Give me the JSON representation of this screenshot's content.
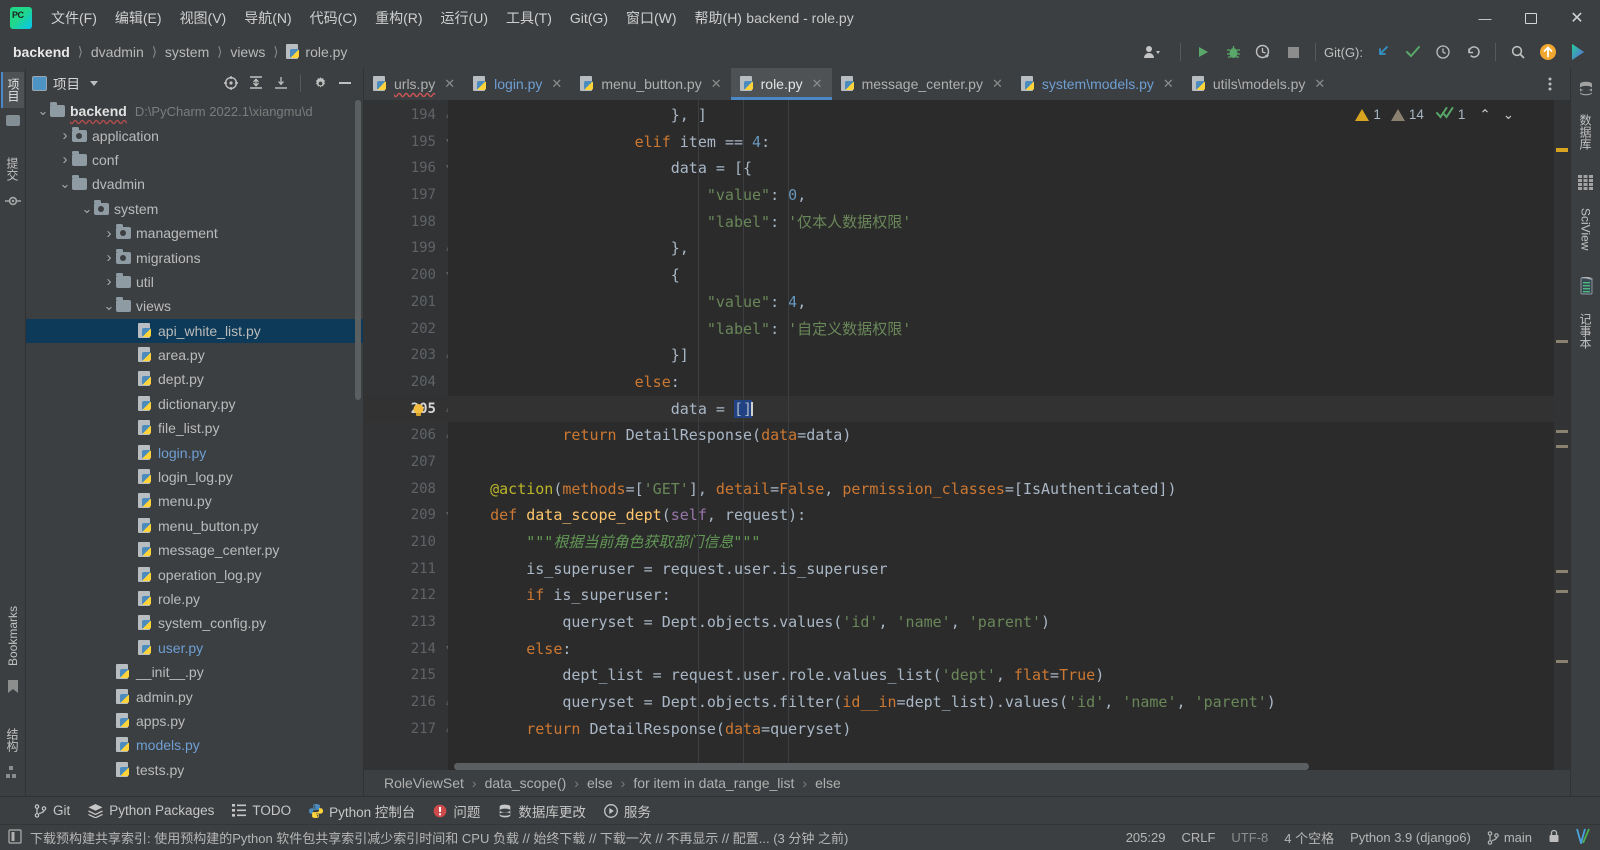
{
  "window": {
    "title": "backend - role.py",
    "minimize": "—",
    "maximize": "❐",
    "close": "✕"
  },
  "menubar": [
    {
      "label": "文件(F)"
    },
    {
      "label": "编辑(E)"
    },
    {
      "label": "视图(V)"
    },
    {
      "label": "导航(N)"
    },
    {
      "label": "代码(C)"
    },
    {
      "label": "重构(R)"
    },
    {
      "label": "运行(U)"
    },
    {
      "label": "工具(T)"
    },
    {
      "label": "Git(G)"
    },
    {
      "label": "窗口(W)"
    },
    {
      "label": "帮助(H)"
    }
  ],
  "navbar": {
    "crumbs": [
      "backend",
      "dvadmin",
      "system",
      "views",
      "role.py"
    ],
    "git_label": "Git(G):",
    "buttons": [
      {
        "name": "profile-dropdown",
        "glyph": "⛭"
      },
      {
        "name": "run-button",
        "glyph": "▶"
      },
      {
        "name": "debug-button",
        "glyph": "☢"
      },
      {
        "name": "run-coverage-button",
        "glyph": "⏱"
      },
      {
        "name": "stop-button",
        "glyph": "■"
      },
      {
        "name": "git-update-button",
        "glyph": "↙"
      },
      {
        "name": "git-commit-button",
        "glyph": "✓"
      },
      {
        "name": "git-history-button",
        "glyph": "◷"
      },
      {
        "name": "git-rollback-button",
        "glyph": "↶"
      },
      {
        "name": "search-everywhere-button",
        "glyph": "⌕"
      },
      {
        "name": "update-available-button",
        "glyph": "↑"
      },
      {
        "name": "feedback-button",
        "glyph": "▶"
      }
    ]
  },
  "left_strip": {
    "tabs": [
      {
        "label": "项目",
        "name": "tool-tab-project",
        "active": true
      },
      {
        "label": "提交",
        "name": "tool-tab-commit",
        "active": false
      }
    ],
    "bottom_tabs": [
      {
        "label": "Bookmarks",
        "name": "tool-tab-bookmarks"
      },
      {
        "label": "结构",
        "name": "tool-tab-structure"
      }
    ]
  },
  "right_strip": {
    "tabs": [
      {
        "label": "数据库",
        "name": "tool-tab-database"
      },
      {
        "label": "SciView",
        "name": "tool-tab-sciview"
      },
      {
        "label": "记事本",
        "name": "tool-tab-notebook"
      }
    ]
  },
  "project_panel": {
    "title": "项目",
    "toolbar": [
      {
        "name": "select-opened-file-icon",
        "glyph": "⊕"
      },
      {
        "name": "expand-all-icon",
        "glyph": "⩯"
      },
      {
        "name": "collapse-all-icon",
        "glyph": "⩰"
      },
      {
        "name": "settings-gear-icon",
        "glyph": "⚙"
      },
      {
        "name": "hide-panel-icon",
        "glyph": "—"
      }
    ],
    "tree": [
      {
        "label": "backend",
        "path": "D:\\PyCharm 2022.1\\xiangmu\\d",
        "indent": 0,
        "arrow": "v",
        "icon": "folder",
        "bold": true,
        "type": "folder"
      },
      {
        "label": "application",
        "indent": 1,
        "arrow": ">",
        "icon": "folder-src",
        "type": "folder"
      },
      {
        "label": "conf",
        "indent": 1,
        "arrow": ">",
        "icon": "folder",
        "type": "folder"
      },
      {
        "label": "dvadmin",
        "indent": 1,
        "arrow": "v",
        "icon": "folder",
        "type": "folder"
      },
      {
        "label": "system",
        "indent": 2,
        "arrow": "v",
        "icon": "folder-src",
        "type": "folder"
      },
      {
        "label": "management",
        "indent": 3,
        "arrow": ">",
        "icon": "folder-src",
        "type": "folder"
      },
      {
        "label": "migrations",
        "indent": 3,
        "arrow": ">",
        "icon": "folder-src",
        "type": "folder"
      },
      {
        "label": "util",
        "indent": 3,
        "arrow": ">",
        "icon": "folder",
        "type": "folder"
      },
      {
        "label": "views",
        "indent": 3,
        "arrow": "v",
        "icon": "folder",
        "type": "folder"
      },
      {
        "label": "api_white_list.py",
        "indent": 4,
        "arrow": "",
        "icon": "py",
        "selected": true,
        "type": "file"
      },
      {
        "label": "area.py",
        "indent": 4,
        "arrow": "",
        "icon": "py",
        "type": "file"
      },
      {
        "label": "dept.py",
        "indent": 4,
        "arrow": "",
        "icon": "py",
        "type": "file"
      },
      {
        "label": "dictionary.py",
        "indent": 4,
        "arrow": "",
        "icon": "py",
        "type": "file"
      },
      {
        "label": "file_list.py",
        "indent": 4,
        "arrow": "",
        "icon": "py",
        "type": "file"
      },
      {
        "label": "login.py",
        "indent": 4,
        "arrow": "",
        "icon": "py",
        "opened": true,
        "type": "file"
      },
      {
        "label": "login_log.py",
        "indent": 4,
        "arrow": "",
        "icon": "py",
        "type": "file"
      },
      {
        "label": "menu.py",
        "indent": 4,
        "arrow": "",
        "icon": "py",
        "type": "file"
      },
      {
        "label": "menu_button.py",
        "indent": 4,
        "arrow": "",
        "icon": "py",
        "type": "file"
      },
      {
        "label": "message_center.py",
        "indent": 4,
        "arrow": "",
        "icon": "py",
        "type": "file"
      },
      {
        "label": "operation_log.py",
        "indent": 4,
        "arrow": "",
        "icon": "py",
        "type": "file"
      },
      {
        "label": "role.py",
        "indent": 4,
        "arrow": "",
        "icon": "py",
        "type": "file"
      },
      {
        "label": "system_config.py",
        "indent": 4,
        "arrow": "",
        "icon": "py",
        "type": "file"
      },
      {
        "label": "user.py",
        "indent": 4,
        "arrow": "",
        "icon": "py",
        "opened": true,
        "type": "file"
      },
      {
        "label": "__init__.py",
        "indent": 3,
        "arrow": "",
        "icon": "py",
        "type": "file"
      },
      {
        "label": "admin.py",
        "indent": 3,
        "arrow": "",
        "icon": "py",
        "type": "file"
      },
      {
        "label": "apps.py",
        "indent": 3,
        "arrow": "",
        "icon": "py",
        "type": "file"
      },
      {
        "label": "models.py",
        "indent": 3,
        "arrow": "",
        "icon": "py",
        "opened": true,
        "type": "file"
      },
      {
        "label": "tests.py",
        "indent": 3,
        "arrow": "",
        "icon": "py",
        "type": "file"
      }
    ]
  },
  "editor": {
    "tabs": [
      {
        "label": "urls.py",
        "active": false,
        "error": true
      },
      {
        "label": "login.py",
        "active": false,
        "blue": true
      },
      {
        "label": "menu_button.py",
        "active": false
      },
      {
        "label": "role.py",
        "active": true
      },
      {
        "label": "message_center.py",
        "active": false
      },
      {
        "label": "system\\models.py",
        "active": false,
        "blue": true
      },
      {
        "label": "utils\\models.py",
        "active": false
      }
    ],
    "inspections": {
      "warnings": "1",
      "weak_warnings": "14",
      "ok": "1",
      "prev_glyph": "⌃",
      "next_glyph": "⌄"
    },
    "first_line": 194,
    "current_line": 205,
    "lines": [
      {
        "n": 194,
        "fold": "△",
        "tokens": [
          {
            "t": "                        }, ]",
            "c": "at"
          }
        ]
      },
      {
        "n": 195,
        "fold": "▽",
        "tokens": [
          {
            "t": "                    ",
            "c": "at"
          },
          {
            "t": "elif",
            "c": "k"
          },
          {
            "t": " item ",
            "c": "at"
          },
          {
            "t": "==",
            "c": "at"
          },
          {
            "t": " ",
            "c": "at"
          },
          {
            "t": "4",
            "c": "n"
          },
          {
            "t": ":",
            "c": "at"
          }
        ]
      },
      {
        "n": 196,
        "fold": "▽",
        "tokens": [
          {
            "t": "                        data = [{",
            "c": "at"
          }
        ]
      },
      {
        "n": 197,
        "fold": "",
        "tokens": [
          {
            "t": "                            ",
            "c": "at"
          },
          {
            "t": "\"value\"",
            "c": "s"
          },
          {
            "t": ": ",
            "c": "at"
          },
          {
            "t": "0",
            "c": "n"
          },
          {
            "t": ",",
            "c": "at"
          }
        ]
      },
      {
        "n": 198,
        "fold": "",
        "tokens": [
          {
            "t": "                            ",
            "c": "at"
          },
          {
            "t": "\"label\"",
            "c": "s"
          },
          {
            "t": ": ",
            "c": "at"
          },
          {
            "t": "'仅本人数据权限'",
            "c": "s"
          }
        ]
      },
      {
        "n": 199,
        "fold": "△",
        "tokens": [
          {
            "t": "                        },",
            "c": "at"
          }
        ]
      },
      {
        "n": 200,
        "fold": "▽",
        "tokens": [
          {
            "t": "                        {",
            "c": "at"
          }
        ]
      },
      {
        "n": 201,
        "fold": "",
        "tokens": [
          {
            "t": "                            ",
            "c": "at"
          },
          {
            "t": "\"value\"",
            "c": "s"
          },
          {
            "t": ": ",
            "c": "at"
          },
          {
            "t": "4",
            "c": "n"
          },
          {
            "t": ",",
            "c": "at"
          }
        ]
      },
      {
        "n": 202,
        "fold": "",
        "tokens": [
          {
            "t": "                            ",
            "c": "at"
          },
          {
            "t": "\"label\"",
            "c": "s"
          },
          {
            "t": ": ",
            "c": "at"
          },
          {
            "t": "'自定义数据权限'",
            "c": "s"
          }
        ]
      },
      {
        "n": 203,
        "fold": "△",
        "tokens": [
          {
            "t": "                        }]",
            "c": "at"
          }
        ]
      },
      {
        "n": 204,
        "fold": "",
        "tokens": [
          {
            "t": "                    ",
            "c": "at"
          },
          {
            "t": "else",
            "c": "k"
          },
          {
            "t": ":",
            "c": "at"
          }
        ]
      },
      {
        "n": 205,
        "fold": "△",
        "current": true,
        "bulb": true,
        "tokens": [
          {
            "t": "                        data = ",
            "c": "at"
          },
          {
            "t": "[]",
            "c": "sel"
          }
        ]
      },
      {
        "n": 206,
        "fold": "△",
        "tokens": [
          {
            "t": "            ",
            "c": "at"
          },
          {
            "t": "return",
            "c": "k"
          },
          {
            "t": " DetailResponse(",
            "c": "at"
          },
          {
            "t": "data",
            "c": "k"
          },
          {
            "t": "=data)",
            "c": "at"
          }
        ]
      },
      {
        "n": 207,
        "fold": "",
        "tokens": [
          {
            "t": "",
            "c": "at"
          }
        ]
      },
      {
        "n": 208,
        "fold": "",
        "tokens": [
          {
            "t": "    ",
            "c": "at"
          },
          {
            "t": "@action",
            "c": "d"
          },
          {
            "t": "(",
            "c": "at"
          },
          {
            "t": "methods",
            "c": "k"
          },
          {
            "t": "=[",
            "c": "at"
          },
          {
            "t": "'GET'",
            "c": "s"
          },
          {
            "t": "], ",
            "c": "at"
          },
          {
            "t": "detail",
            "c": "k"
          },
          {
            "t": "=",
            "c": "at"
          },
          {
            "t": "False",
            "c": "k"
          },
          {
            "t": ", ",
            "c": "at"
          },
          {
            "t": "permission_classes",
            "c": "k"
          },
          {
            "t": "=[IsAuthenticated])",
            "c": "at"
          }
        ]
      },
      {
        "n": 209,
        "fold": "▽",
        "tokens": [
          {
            "t": "    ",
            "c": "at"
          },
          {
            "t": "def",
            "c": "k"
          },
          {
            "t": " ",
            "c": "at"
          },
          {
            "t": "data_scope_dept",
            "c": "f"
          },
          {
            "t": "(",
            "c": "at"
          },
          {
            "t": "self",
            "c": "p"
          },
          {
            "t": ", request):",
            "c": "at"
          }
        ]
      },
      {
        "n": 210,
        "fold": "",
        "tokens": [
          {
            "t": "        ",
            "c": "at"
          },
          {
            "t": "\"\"\"根据当前角色获取部门信息\"\"\"",
            "c": "cm"
          }
        ]
      },
      {
        "n": 211,
        "fold": "",
        "tokens": [
          {
            "t": "        is_superuser = request.user.is_superuser",
            "c": "at"
          }
        ]
      },
      {
        "n": 212,
        "fold": "",
        "tokens": [
          {
            "t": "        ",
            "c": "at"
          },
          {
            "t": "if",
            "c": "k"
          },
          {
            "t": " is_superuser:",
            "c": "at"
          }
        ]
      },
      {
        "n": 213,
        "fold": "",
        "tokens": [
          {
            "t": "            queryset = Dept.objects.values(",
            "c": "at"
          },
          {
            "t": "'id'",
            "c": "s"
          },
          {
            "t": ", ",
            "c": "at"
          },
          {
            "t": "'name'",
            "c": "s"
          },
          {
            "t": ", ",
            "c": "at"
          },
          {
            "t": "'parent'",
            "c": "s"
          },
          {
            "t": ")",
            "c": "at"
          }
        ]
      },
      {
        "n": 214,
        "fold": "▽",
        "tokens": [
          {
            "t": "        ",
            "c": "at"
          },
          {
            "t": "else",
            "c": "k"
          },
          {
            "t": ":",
            "c": "at"
          }
        ]
      },
      {
        "n": 215,
        "fold": "",
        "tokens": [
          {
            "t": "            dept_list = request.user.role.values_list(",
            "c": "at"
          },
          {
            "t": "'dept'",
            "c": "s"
          },
          {
            "t": ", ",
            "c": "at"
          },
          {
            "t": "flat",
            "c": "k"
          },
          {
            "t": "=",
            "c": "at"
          },
          {
            "t": "True",
            "c": "k"
          },
          {
            "t": ")",
            "c": "at"
          }
        ]
      },
      {
        "n": 216,
        "fold": "△",
        "tokens": [
          {
            "t": "            queryset = Dept.objects.filter(",
            "c": "at"
          },
          {
            "t": "id__in",
            "c": "k"
          },
          {
            "t": "=dept_list).values(",
            "c": "at"
          },
          {
            "t": "'id'",
            "c": "s"
          },
          {
            "t": ", ",
            "c": "at"
          },
          {
            "t": "'name'",
            "c": "s"
          },
          {
            "t": ", ",
            "c": "at"
          },
          {
            "t": "'parent'",
            "c": "s"
          },
          {
            "t": ")",
            "c": "at"
          }
        ]
      },
      {
        "n": 217,
        "fold": "△",
        "tokens": [
          {
            "t": "        ",
            "c": "at"
          },
          {
            "t": "return",
            "c": "k"
          },
          {
            "t": " DetailResponse(",
            "c": "at"
          },
          {
            "t": "data",
            "c": "k"
          },
          {
            "t": "=queryset)",
            "c": "at"
          }
        ]
      }
    ],
    "breadcrumbs": [
      "RoleViewSet",
      "data_scope()",
      "else",
      "for item in data_range_list",
      "else"
    ]
  },
  "toolwindows": [
    {
      "label": "Git",
      "icon": "branch-icon"
    },
    {
      "label": "Python Packages",
      "icon": "packages-icon"
    },
    {
      "label": "TODO",
      "icon": "todo-icon"
    },
    {
      "label": "Python 控制台",
      "icon": "python-icon"
    },
    {
      "label": "问题",
      "icon": "problems-icon"
    },
    {
      "label": "数据库更改",
      "icon": "db-changes-icon"
    },
    {
      "label": "服务",
      "icon": "services-icon"
    }
  ],
  "statusbar": {
    "message": "下载预构建共享索引: 使用预构建的Python 软件包共享索引减少索引时间和 CPU 负载 // 始终下载 // 下载一次 // 不再显示 // 配置... (3 分钟 之前)",
    "caret": "205:29",
    "line_sep": "CRLF",
    "encoding": "UTF-8",
    "indent": "4 个空格",
    "interpreter": "Python 3.9 (django6)",
    "branch": "main",
    "lock_icon": "🔒"
  }
}
